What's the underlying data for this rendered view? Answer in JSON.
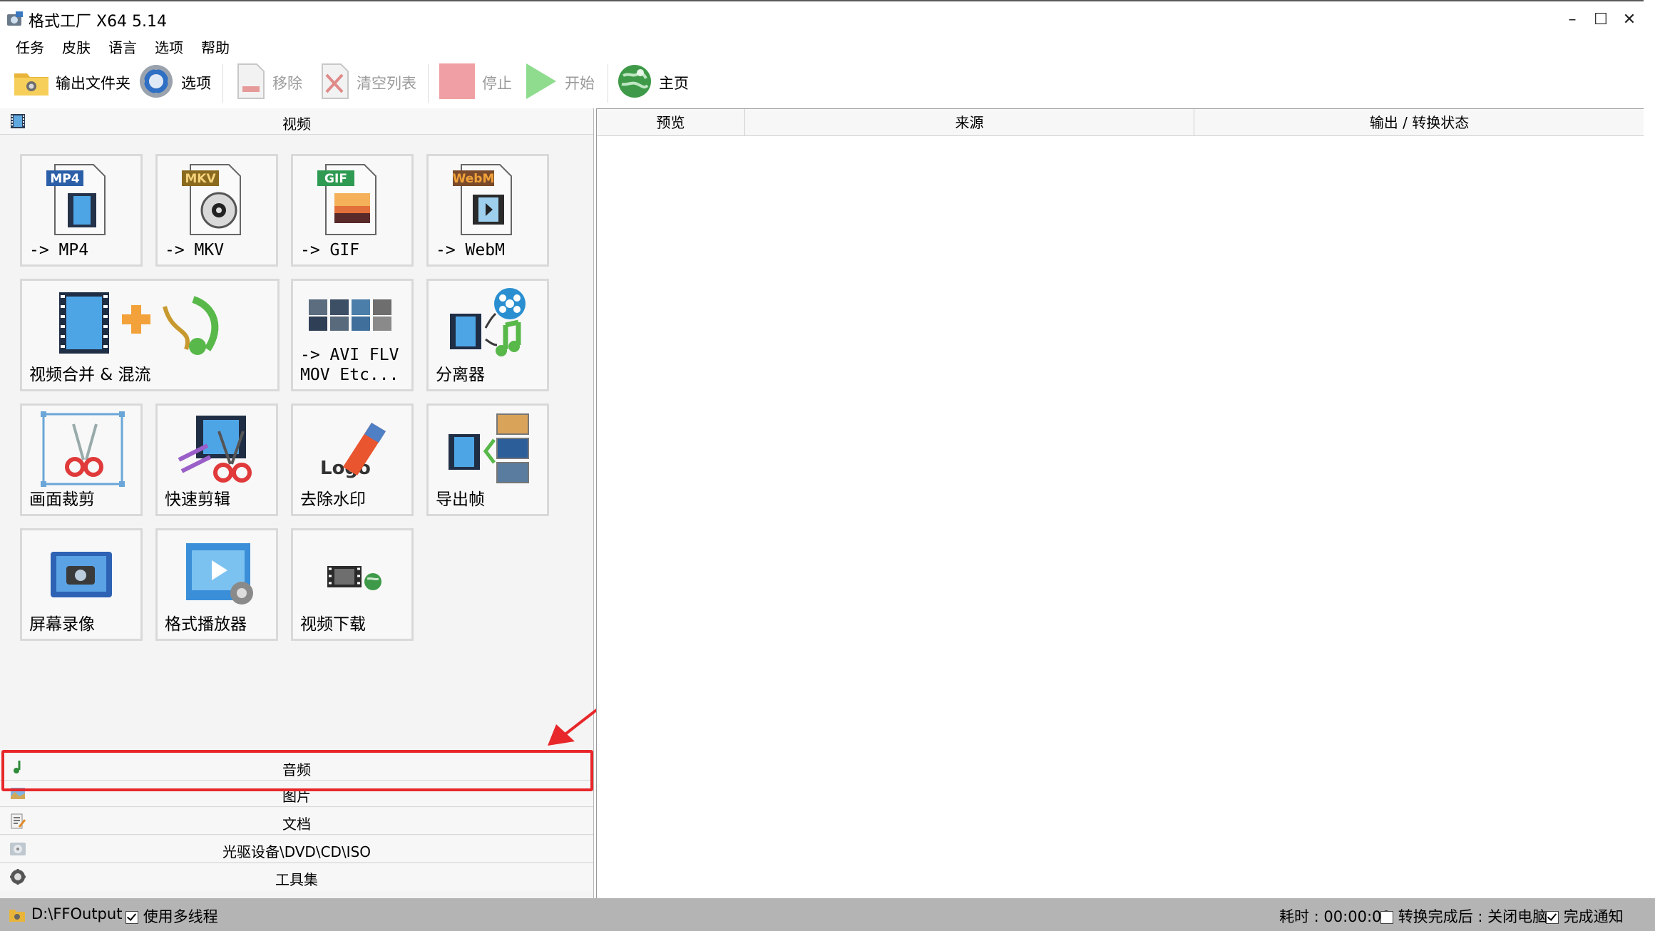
{
  "window": {
    "title": "格式工厂 X64 5.14",
    "controls": {
      "minimize": "–",
      "maximize": "☐",
      "close": "✕"
    }
  },
  "menu": [
    "任务",
    "皮肤",
    "语言",
    "选项",
    "帮助"
  ],
  "toolbar": {
    "output_folder": "输出文件夹",
    "options": "选项",
    "remove": "移除",
    "clear_list": "清空列表",
    "stop": "停止",
    "start": "开始",
    "home": "主页"
  },
  "categories": {
    "video": "视频",
    "audio": "音频",
    "image": "图片",
    "document": "文档",
    "optical": "光驱设备\\DVD\\CD\\ISO",
    "tools": "工具集"
  },
  "video_tiles": [
    {
      "label": "-> MP4",
      "badge": "MP4",
      "badge_color": "#2b5fa8",
      "icon": "mp4-file-icon"
    },
    {
      "label": "-> MKV",
      "badge": "MKV",
      "badge_color": "#8a6a1f",
      "icon": "mkv-file-icon"
    },
    {
      "label": "-> GIF",
      "badge": "GIF",
      "badge_color": "#2f9a52",
      "icon": "gif-file-icon"
    },
    {
      "label": "-> WebM",
      "badge": "WebM",
      "badge_color": "#7a4a2a",
      "icon": "webm-file-icon"
    },
    {
      "label": "视频合并 & 混流",
      "icon": "merge-mux-icon"
    },
    {
      "label": "-> AVI FLV\nMOV Etc...",
      "icon": "other-formats-icon"
    },
    {
      "label": "分离器",
      "icon": "demuxer-icon"
    },
    {
      "label": "画面裁剪",
      "icon": "crop-icon"
    },
    {
      "label": "快速剪辑",
      "icon": "quick-clip-icon"
    },
    {
      "label": "去除水印",
      "icon": "remove-watermark-icon"
    },
    {
      "label": "导出帧",
      "icon": "export-frames-icon"
    },
    {
      "label": "屏幕录像",
      "icon": "screen-record-icon"
    },
    {
      "label": "格式播放器",
      "icon": "player-icon"
    },
    {
      "label": "视频下载",
      "icon": "video-download-icon"
    }
  ],
  "task_table": {
    "columns": [
      "预览",
      "来源",
      "输出 / 转换状态"
    ]
  },
  "status": {
    "output_path": "D:\\FFOutput",
    "multithread_label": "使用多线程",
    "multithread_checked": true,
    "elapsed": "耗时 : 00:00:00",
    "after_convert": "转换完成后 : 关闭电脑",
    "after_convert_checked": false,
    "notify": "完成通知",
    "notify_checked": true
  },
  "colors": {
    "highlight_box": "#e8272a",
    "status_bar": "#b4b4b4",
    "tile_border": "#d9d9d9"
  }
}
